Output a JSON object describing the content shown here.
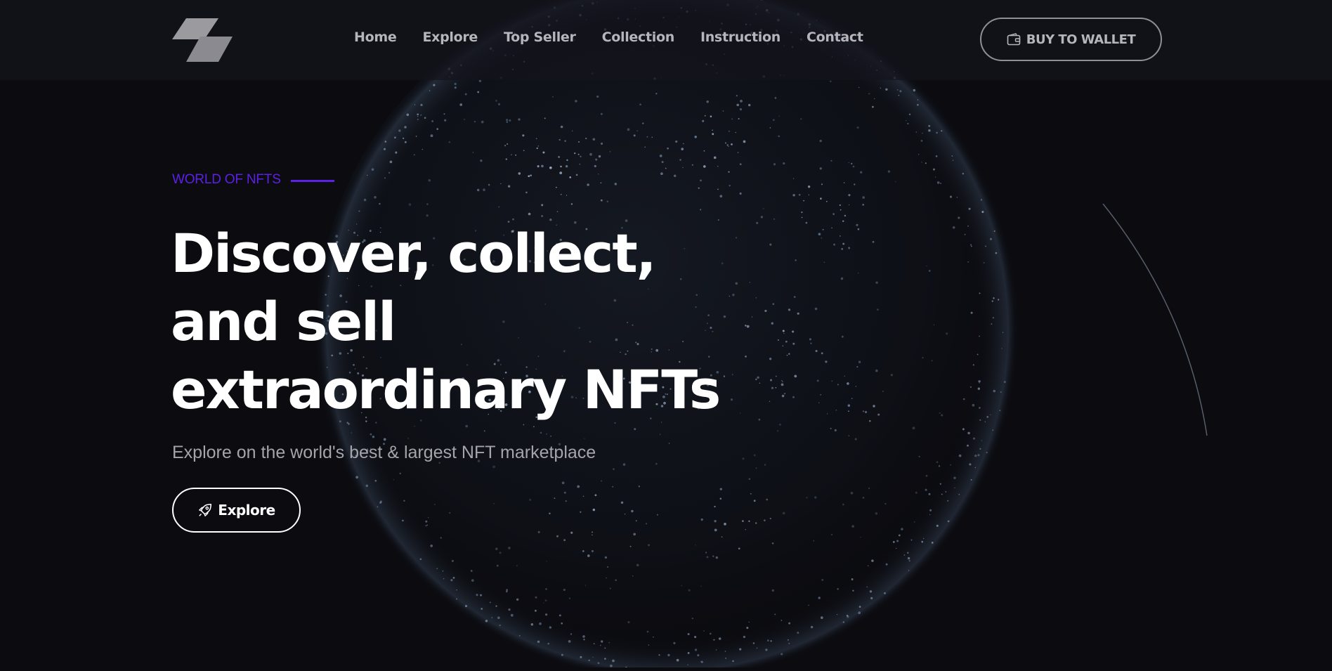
{
  "colors": {
    "background": "#0b0b10",
    "header_bg": "#16161d",
    "accent": "#5b21e6",
    "nav_text": "#b5b5bb",
    "headline": "#ffffff",
    "subtitle": "#a4a4aa"
  },
  "header": {
    "logo_icon": "stacked-parallelogram-logo",
    "nav": [
      {
        "label": "Home"
      },
      {
        "label": "Explore"
      },
      {
        "label": "Top Seller"
      },
      {
        "label": "Collection"
      },
      {
        "label": "Instruction"
      },
      {
        "label": "Contact"
      }
    ],
    "wallet_button": {
      "icon": "wallet-icon",
      "label": "BUY TO WALLET"
    }
  },
  "hero": {
    "eyebrow": "WORLD OF NFTS",
    "headline_lines": [
      "Discover, collect,",
      "and sell",
      "extraordinary NFTs"
    ],
    "subtitle": "Explore on the world's best & largest NFT marketplace",
    "cta": {
      "icon": "rocket-icon",
      "label": "Explore"
    },
    "background_icon": "dotted-globe-graphic"
  }
}
